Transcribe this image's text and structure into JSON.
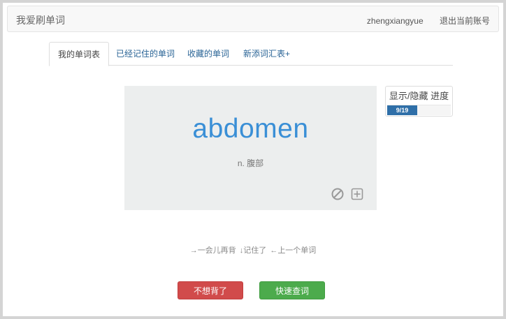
{
  "navbar": {
    "brand": "我爱刷单词",
    "username": "zhengxiangyue",
    "logout": "退出当前账号"
  },
  "tabs": [
    {
      "label": "我的单词表",
      "active": true
    },
    {
      "label": "已经记住的单词",
      "active": false
    },
    {
      "label": "收藏的单词",
      "active": false
    },
    {
      "label": "新添词汇表+",
      "active": false
    }
  ],
  "card": {
    "word": "abdomen",
    "meaning": "n. 腹部",
    "icons": [
      "ban-icon",
      "plus-square-icon"
    ]
  },
  "progress": {
    "title": "显示/隐藏 进度",
    "label": "9/19",
    "current": 9,
    "total": 19
  },
  "hints": {
    "later": "→一会儿再背",
    "remembered": "↓记住了",
    "previous": "←上一个单词"
  },
  "buttons": {
    "skip": "不想背了",
    "lookup": "快速查词"
  },
  "colors": {
    "word": "#3a8fd6",
    "progress": "#2f6fa8",
    "danger": "#d14b4b",
    "success": "#4cab4c"
  }
}
